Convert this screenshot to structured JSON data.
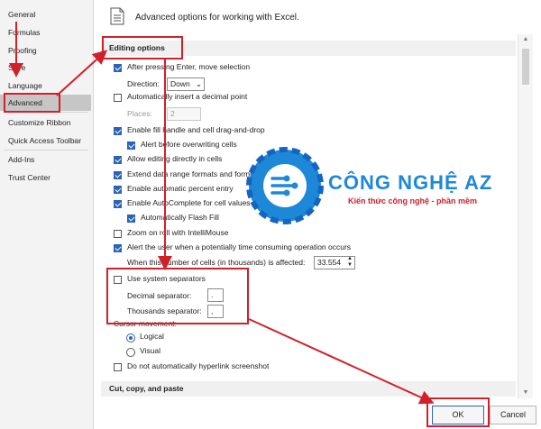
{
  "nav": {
    "items": [
      "General",
      "Formulas",
      "Proofing",
      "Save",
      "Language",
      "Advanced",
      "Customize Ribbon",
      "Quick Access Toolbar",
      "Add-Ins",
      "Trust Center"
    ]
  },
  "header": {
    "title": "Advanced options for working with Excel."
  },
  "sections": {
    "editing": "Editing options",
    "cut_copy": "Cut, copy, and paste"
  },
  "options": {
    "after_enter": "After pressing Enter, move selection",
    "direction_label": "Direction:",
    "direction_value": "Down",
    "auto_decimal": "Automatically insert a decimal point",
    "places_label": "Places:",
    "places_value": "2",
    "fill_handle": "Enable fill handle and cell drag-and-drop",
    "alert_overwrite": "Alert before overwriting cells",
    "allow_editing": "Allow editing directly in cells",
    "extend_formats": "Extend data range formats and formulas",
    "auto_percent": "Enable automatic percent entry",
    "autocomplete": "Enable AutoComplete for cell values",
    "flash_fill": "Automatically Flash Fill",
    "zoom_roll": "Zoom on roll with IntelliMouse",
    "alert_time": "Alert the user when a potentially time consuming operation occurs",
    "cells_affected_label": "When this number of cells (in thousands) is affected:",
    "cells_affected_value": "33.554",
    "use_system_sep": "Use system separators",
    "decimal_sep_label": "Decimal separator:",
    "decimal_sep_value": ".",
    "thousands_sep_label": "Thousands separator:",
    "thousands_sep_value": ",",
    "cursor_movement": "Cursor movement:",
    "logical": "Logical",
    "visual": "Visual",
    "no_hyperlink": "Do not automatically hyperlink screenshot"
  },
  "logo": {
    "brand": "CÔNG NGHỆ AZ",
    "tagline": "Kiến thức công nghệ - phần mềm"
  },
  "buttons": {
    "ok": "OK",
    "cancel": "Cancel"
  },
  "colors": {
    "accent": "#2b64b4",
    "annotation": "#d2202a",
    "logo_blue": "#1e88d8"
  }
}
